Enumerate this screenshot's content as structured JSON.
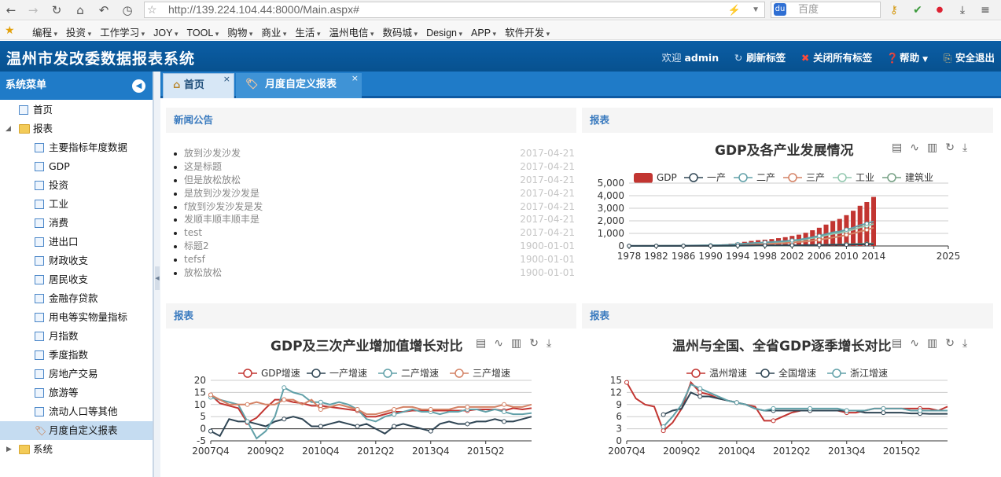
{
  "browser": {
    "url": "http://139.224.104.44:8000/Main.aspx#",
    "search_placeholder": "百度",
    "bookmarks": [
      "编程",
      "投资",
      "工作学习",
      "JOY",
      "TOOL",
      "购物",
      "商业",
      "生活",
      "温州电信",
      "数码城",
      "Design",
      "APP",
      "软件开发"
    ]
  },
  "app": {
    "title": "温州市发改委数据报表系统",
    "welcome": "欢迎",
    "user": "admin",
    "refresh_label": "刷新标签",
    "close_all_label": "关闭所有标签",
    "help_label": "帮助",
    "logout_label": "安全退出"
  },
  "sidebar": {
    "header": "系统菜单",
    "home": "首页",
    "reports_folder": "报表",
    "items": [
      "主要指标年度数据",
      "GDP",
      "投资",
      "工业",
      "消费",
      "进出口",
      "财政收支",
      "居民收支",
      "金融存贷款",
      "用电等实物量指标",
      "月指数",
      "季度指数",
      "房地产交易",
      "旅游等",
      "流动人口等其他",
      "月度自定义报表"
    ],
    "system_folder": "系统"
  },
  "tabs": [
    {
      "label": "首页",
      "close": "×"
    },
    {
      "label": "月度自定义报表",
      "close": "×"
    }
  ],
  "panels": {
    "news_title": "新闻公告",
    "report_title": "报表"
  },
  "news": [
    {
      "title": "放到沙发沙发",
      "date": "2017-04-21"
    },
    {
      "title": "这是标题",
      "date": "2017-04-21"
    },
    {
      "title": "但是放松放松",
      "date": "2017-04-21"
    },
    {
      "title": "是放到沙发沙发是",
      "date": "2017-04-21"
    },
    {
      "title": "f放到沙发沙发是发",
      "date": "2017-04-21"
    },
    {
      "title": "发顺丰顺丰顺丰是",
      "date": "2017-04-21"
    },
    {
      "title": "test",
      "date": "2017-04-21"
    },
    {
      "title": "标题2",
      "date": "1900-01-01"
    },
    {
      "title": "tefsf",
      "date": "1900-01-01"
    },
    {
      "title": "放松放松",
      "date": "1900-01-01"
    }
  ],
  "colors": {
    "gdp": "#c23531",
    "primary": "#2f4554",
    "secondary": "#61a0a8",
    "tertiary": "#d48265",
    "industry": "#91c7ae",
    "construction": "#749f83",
    "brand": "#0b5ea6"
  },
  "chart_data": [
    {
      "type": "bar",
      "title": "GDP及各产业发展情况",
      "x": [
        1978,
        1979,
        1980,
        1981,
        1982,
        1983,
        1984,
        1985,
        1986,
        1987,
        1988,
        1989,
        1990,
        1991,
        1992,
        1993,
        1994,
        1995,
        1996,
        1997,
        1998,
        1999,
        2000,
        2001,
        2002,
        2003,
        2004,
        2005,
        2006,
        2007,
        2008,
        2009,
        2010,
        2011,
        2012,
        2013,
        2014
      ],
      "xticks": [
        "1978",
        "1982",
        "1986",
        "1990",
        "1994",
        "1998",
        "2002",
        "2006",
        "2010",
        "2014",
        "2025"
      ],
      "ylim": [
        0,
        5000
      ],
      "yticks": [
        "0",
        "1,000",
        "2,000",
        "3,000",
        "4,000",
        "5,000"
      ],
      "series": [
        {
          "name": "GDP",
          "type": "bar",
          "values": [
            13,
            15,
            17,
            19,
            21,
            25,
            30,
            39,
            47,
            57,
            74,
            85,
            92,
            106,
            132,
            180,
            260,
            330,
            400,
            460,
            500,
            550,
            620,
            700,
            800,
            900,
            1050,
            1250,
            1450,
            1700,
            1980,
            2150,
            2450,
            2800,
            3200,
            3500,
            3900
          ]
        },
        {
          "name": "一产",
          "type": "line",
          "values": [
            5,
            6,
            6,
            7,
            7,
            8,
            9,
            10,
            11,
            13,
            15,
            17,
            18,
            19,
            21,
            25,
            30,
            35,
            40,
            44,
            46,
            48,
            50,
            52,
            55,
            58,
            63,
            67,
            72,
            80,
            90,
            95,
            105,
            115,
            125,
            135,
            140
          ]
        },
        {
          "name": "二产",
          "type": "line",
          "values": [
            6,
            7,
            8,
            9,
            10,
            12,
            15,
            19,
            24,
            30,
            40,
            46,
            50,
            58,
            74,
            100,
            150,
            190,
            230,
            260,
            285,
            310,
            350,
            390,
            440,
            500,
            590,
            700,
            800,
            940,
            1080,
            1150,
            1300,
            1450,
            1650,
            1780,
            1950
          ]
        },
        {
          "name": "三产",
          "type": "line",
          "values": [
            3,
            3,
            4,
            4,
            5,
            5,
            6,
            8,
            10,
            12,
            15,
            18,
            20,
            24,
            32,
            48,
            70,
            90,
            110,
            130,
            150,
            170,
            200,
            230,
            270,
            310,
            360,
            420,
            490,
            580,
            670,
            760,
            880,
            1000,
            1150,
            1280,
            1450
          ]
        },
        {
          "name": "工业",
          "type": "line",
          "values": [
            5,
            6,
            7,
            8,
            9,
            11,
            13,
            17,
            21,
            27,
            35,
            41,
            44,
            51,
            66,
            90,
            135,
            170,
            205,
            235,
            255,
            280,
            315,
            350,
            395,
            450,
            530,
            630,
            720,
            850,
            970,
            1030,
            1170,
            1300,
            1480,
            1600,
            1750
          ]
        },
        {
          "name": "建筑业",
          "type": "line",
          "values": [
            1,
            1,
            1,
            1,
            1,
            1,
            2,
            2,
            3,
            3,
            4,
            5,
            5,
            6,
            8,
            10,
            15,
            20,
            25,
            28,
            30,
            32,
            35,
            40,
            45,
            50,
            60,
            70,
            80,
            90,
            110,
            120,
            130,
            150,
            170,
            180,
            200
          ]
        }
      ]
    },
    {
      "type": "line",
      "title": "GDP及三次产业增加值增长对比",
      "categories": [
        "2007Q4",
        "2008Q1",
        "2008Q2",
        "2008Q3",
        "2008Q4",
        "2009Q1",
        "2009Q2",
        "2009Q3",
        "2009Q4",
        "2010Q1",
        "2010Q2",
        "2010Q3",
        "2010Q4",
        "2011Q1",
        "2011Q2",
        "2011Q3",
        "2011Q4",
        "2012Q1",
        "2012Q2",
        "2012Q3",
        "2012Q4",
        "2013Q1",
        "2013Q2",
        "2013Q3",
        "2013Q4",
        "2014Q1",
        "2014Q2",
        "2014Q3",
        "2014Q4",
        "2015Q1",
        "2015Q2",
        "2015Q3",
        "2015Q4",
        "2016Q1",
        "2016Q2",
        "2016Q3"
      ],
      "xticks": [
        "2007Q4",
        "2009Q2",
        "2010Q4",
        "2012Q2",
        "2013Q4",
        "2015Q2"
      ],
      "ylim": [
        -5,
        20
      ],
      "yticks": [
        "-5",
        "0",
        "5",
        "10",
        "15",
        "20"
      ],
      "series": [
        {
          "name": "GDP增速",
          "values": [
            14,
            10.5,
            9.5,
            8.5,
            2.5,
            4.5,
            8.5,
            12,
            12,
            11,
            10.5,
            9.5,
            9.5,
            9,
            8.5,
            8,
            7.5,
            5,
            5,
            6,
            7,
            7,
            7.5,
            7.5,
            7.5,
            7.5,
            7.5,
            7.5,
            7.5,
            8,
            8,
            8,
            7.5,
            8.5,
            8,
            8.5
          ]
        },
        {
          "name": "一产增速",
          "values": [
            -1,
            -3,
            4,
            3,
            3,
            2,
            1,
            3,
            4,
            5,
            4,
            1,
            1,
            2,
            3,
            2,
            1,
            2,
            0,
            -2,
            1,
            2,
            1,
            0,
            -1,
            2,
            3,
            2,
            2,
            3,
            3,
            4,
            3,
            3,
            4,
            5
          ]
        },
        {
          "name": "二产增速",
          "values": [
            13,
            12,
            11,
            10,
            3,
            -4,
            -1,
            5,
            17,
            15,
            14,
            11,
            11,
            10,
            11,
            10,
            8,
            4,
            3,
            5,
            6,
            7,
            8,
            7,
            7,
            6,
            7,
            7,
            8,
            8,
            7,
            8,
            7,
            6,
            6,
            6.5
          ]
        },
        {
          "name": "三产增速",
          "values": [
            14,
            12,
            10,
            10,
            10,
            11,
            10,
            10,
            12,
            12,
            10,
            12,
            8,
            9,
            10,
            9,
            8,
            6,
            6,
            7,
            8,
            9,
            9,
            8,
            8,
            8,
            8,
            9,
            9,
            9,
            9,
            9,
            10,
            9,
            9,
            10
          ]
        }
      ]
    },
    {
      "type": "line",
      "title": "温州与全国、全省GDP逐季增长对比",
      "categories": [
        "2007Q4",
        "2008Q1",
        "2008Q2",
        "2008Q3",
        "2008Q4",
        "2009Q1",
        "2009Q2",
        "2009Q3",
        "2009Q4",
        "2010Q1",
        "2010Q2",
        "2010Q3",
        "2010Q4",
        "2011Q1",
        "2011Q2",
        "2011Q3",
        "2011Q4",
        "2012Q1",
        "2012Q2",
        "2012Q3",
        "2012Q4",
        "2013Q1",
        "2013Q2",
        "2013Q3",
        "2013Q4",
        "2014Q1",
        "2014Q2",
        "2014Q3",
        "2014Q4",
        "2015Q1",
        "2015Q2",
        "2015Q3",
        "2015Q4",
        "2016Q1",
        "2016Q2",
        "2016Q3"
      ],
      "xticks": [
        "2007Q4",
        "2009Q2",
        "2010Q4",
        "2012Q2",
        "2013Q4",
        "2015Q2"
      ],
      "ylim": [
        0,
        15
      ],
      "yticks": [
        "0",
        "3",
        "6",
        "9",
        "12",
        "15"
      ],
      "series": [
        {
          "name": "温州增速",
          "values": [
            14.5,
            10.5,
            9,
            8.5,
            2.5,
            4.5,
            8,
            14.5,
            12,
            11.5,
            10.5,
            10,
            9.5,
            9,
            8.5,
            5,
            5,
            6,
            7,
            7.5,
            7.5,
            7.5,
            7.5,
            7.5,
            7,
            7,
            7.5,
            8,
            8,
            8,
            8,
            8,
            8,
            8,
            7.5,
            8.5
          ]
        },
        {
          "name": "全国增速",
          "values": [
            null,
            null,
            null,
            null,
            6.5,
            7.5,
            8,
            12,
            11,
            11,
            10.5,
            10,
            9.5,
            9,
            8,
            7.5,
            7.5,
            7.5,
            7.5,
            7.5,
            7.5,
            7.5,
            7.5,
            7.5,
            7.5,
            7.5,
            7,
            7,
            7,
            7,
            7,
            6.8,
            6.8,
            6.7,
            6.7,
            6.7
          ]
        },
        {
          "name": "浙江增速",
          "values": [
            null,
            null,
            null,
            null,
            3.5,
            6,
            9,
            14,
            13,
            12,
            11,
            10,
            9.5,
            9,
            8,
            7.5,
            8,
            8,
            8,
            8,
            8,
            8,
            8,
            8,
            7.5,
            7.5,
            7.5,
            8,
            8,
            8,
            8,
            7.5,
            7.5,
            7.5,
            7.5,
            7.5
          ]
        }
      ]
    }
  ]
}
